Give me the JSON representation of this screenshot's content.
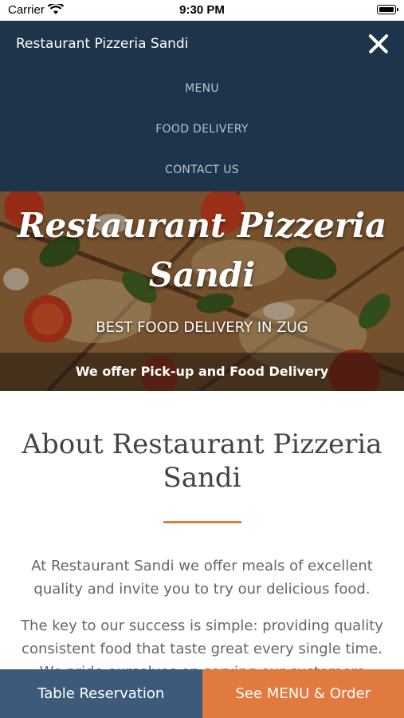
{
  "status_bar": {
    "carrier": "Carrier",
    "time": "9:30 PM"
  },
  "nav": {
    "brand": "Restaurant Pizzeria Sandi",
    "items": [
      {
        "label": "MENU"
      },
      {
        "label": "FOOD DELIVERY"
      },
      {
        "label": "CONTACT US"
      }
    ]
  },
  "hero": {
    "title_line1": "Restaurant Pizzeria",
    "title_line2": "Sandi",
    "tagline": "BEST FOOD DELIVERY IN ZUG",
    "band": "We offer Pick-up and Food Delivery"
  },
  "about": {
    "title_line1": "About Restaurant Pizzeria",
    "title_line2": "Sandi",
    "p1_line1": "At Restaurant Sandi we offer meals of excellent",
    "p1_line2": "quality and invite you to try our delicious food.",
    "p2_line1": "The key to our success is simple: providing quality",
    "p2_line2": "consistent food that taste great every single time.",
    "p2_line3": "We pride ourselves on serving our customers"
  },
  "buttons": {
    "reserve": "Table Reservation",
    "order": "See MENU & Order"
  },
  "colors": {
    "nav_bg": "#1e344a",
    "accent_orange": "#e07a3f",
    "reserve_blue": "#3d5a7a"
  },
  "icons": [
    "wifi-icon",
    "battery-icon",
    "close-icon"
  ]
}
